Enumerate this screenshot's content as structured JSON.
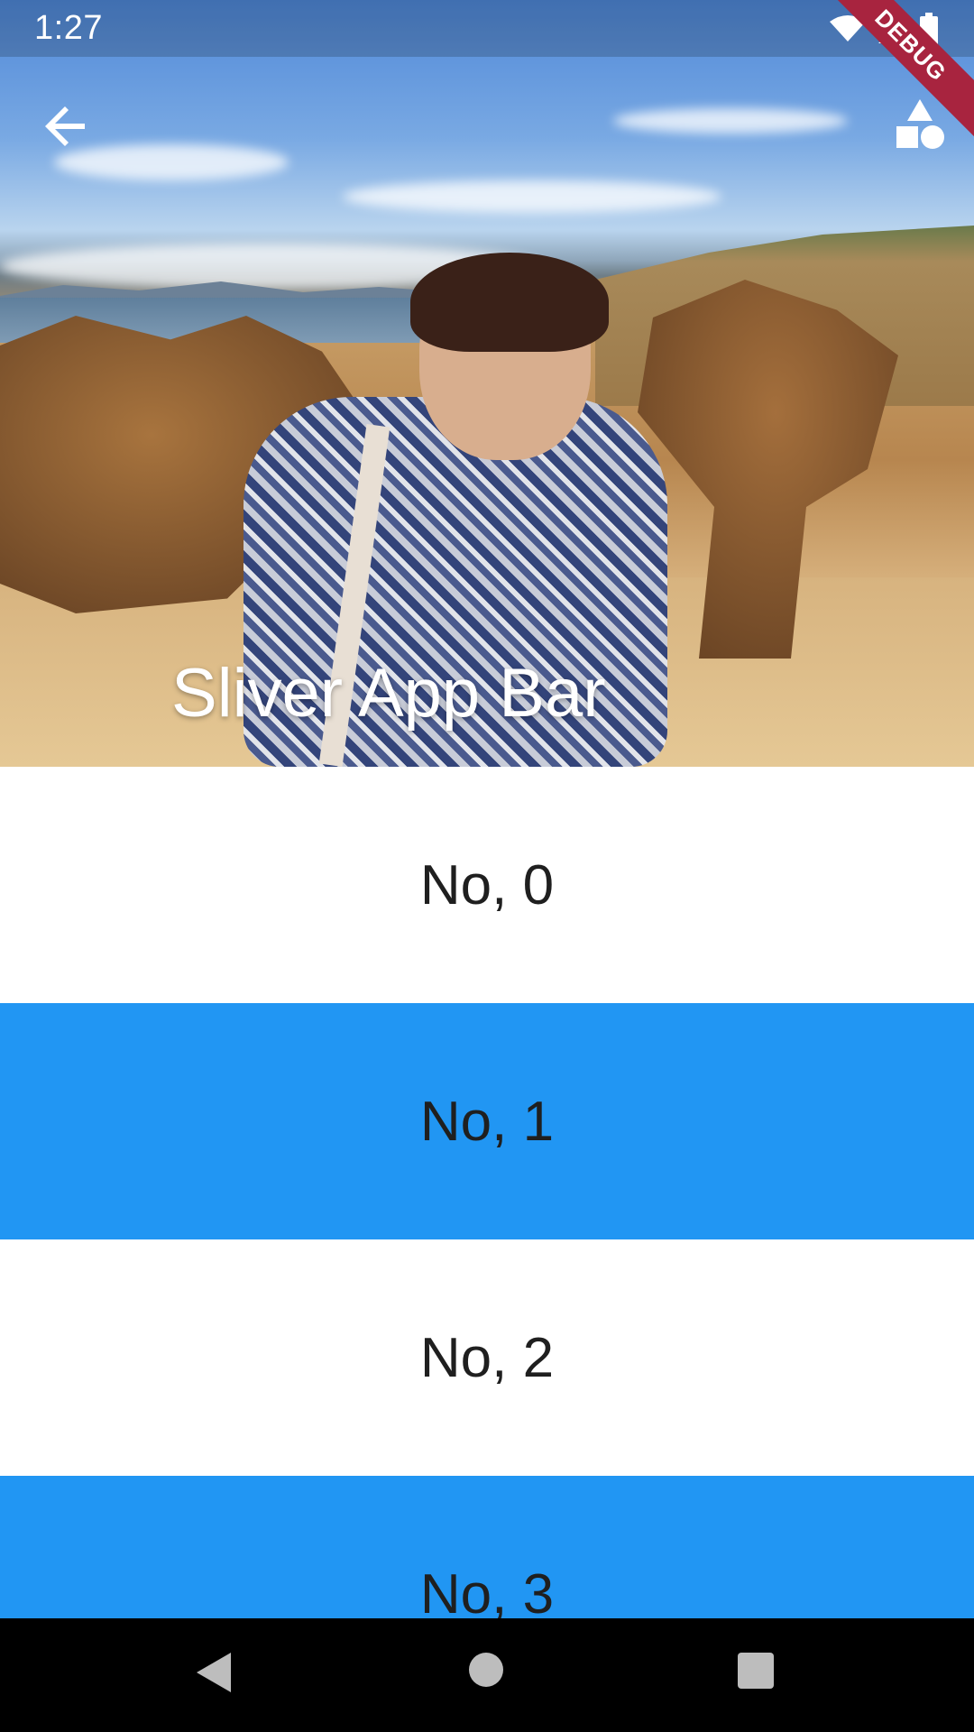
{
  "status_bar": {
    "time": "1:27",
    "debug_label": "DEBUG"
  },
  "app_bar": {
    "title": "Sliver App Bar"
  },
  "list": {
    "items": [
      {
        "label": "No, 0",
        "color": "#ffffff"
      },
      {
        "label": "No, 1",
        "color": "#2196f3"
      },
      {
        "label": "No, 2",
        "color": "#ffffff"
      },
      {
        "label": "No, 3",
        "color": "#2196f3"
      }
    ]
  },
  "colors": {
    "accent_blue": "#2196f3",
    "debug_red": "#a8243f"
  },
  "icons": [
    "back-arrow-icon",
    "shapes-icon",
    "wifi-icon",
    "signal-icon",
    "battery-icon",
    "nav-back-icon",
    "nav-home-icon",
    "nav-recents-icon"
  ]
}
